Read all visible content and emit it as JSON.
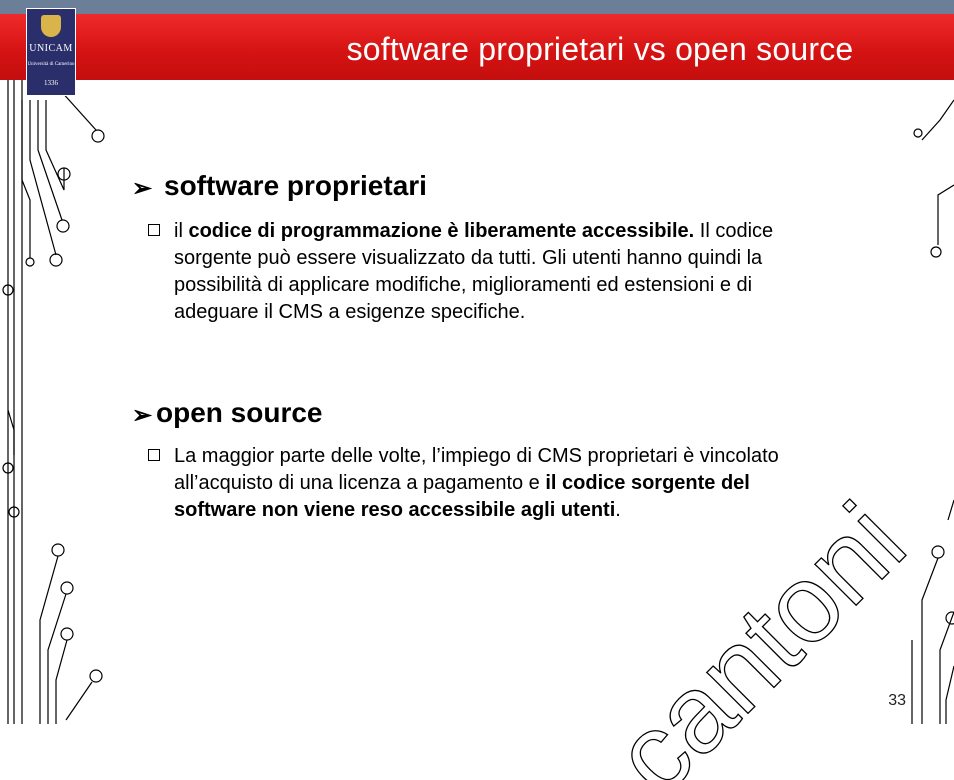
{
  "slide": {
    "title": "software proprietari vs open source",
    "page_number": "33"
  },
  "logo": {
    "name": "UNICAM",
    "subtitle": "Università di Camerino",
    "year": "1336"
  },
  "sections": [
    {
      "heading": "software proprietari",
      "paragraph": {
        "prefix": "il ",
        "bold": "codice di programmazione è liberamente accessibile.",
        "rest": " Il codice sorgente può essere visualizzato da tutti. Gli utenti hanno quindi la possibilità di applicare modifiche, miglioramenti ed estensioni e di adeguare il CMS a esigenze specifiche."
      }
    },
    {
      "heading": "open source",
      "paragraph": {
        "prefix": "La maggior parte delle volte, l’impiego di CMS proprietari è vincolato all’acquisto di una licenza a pagamento e ",
        "bold": "il codice sorgente del software non viene reso accessibile agli utenti",
        "rest": "."
      }
    }
  ],
  "watermark": {
    "text": "cantoni"
  },
  "colors": {
    "title_bar": "#d41212",
    "top_bar": "#6b7f99",
    "logo_bg": "#2a2f6b"
  }
}
